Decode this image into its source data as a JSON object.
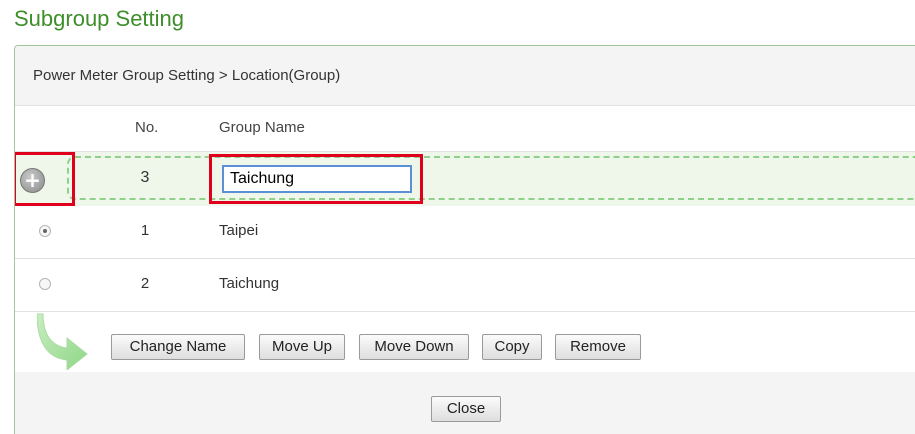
{
  "title": "Subgroup Setting",
  "breadcrumb": "Power Meter Group Setting > Location(Group)",
  "table": {
    "headers": {
      "no": "No.",
      "group_name": "Group Name"
    },
    "new_row": {
      "no": "3",
      "input_value": "Taichung"
    },
    "rows": [
      {
        "no": "1",
        "name": "Taipei",
        "selected": true
      },
      {
        "no": "2",
        "name": "Taichung",
        "selected": false
      }
    ]
  },
  "icons": {
    "add": "plus-circle-icon",
    "arrow": "curved-arrow-icon"
  },
  "buttons": {
    "change_name": "Change Name",
    "move_up": "Move Up",
    "move_down": "Move Down",
    "copy": "Copy",
    "remove": "Remove",
    "close": "Close"
  },
  "colors": {
    "title": "#3e8e2a",
    "highlight": "#e0001b",
    "dash": "#8fd08a",
    "add_row_bg": "#eef7e9"
  }
}
